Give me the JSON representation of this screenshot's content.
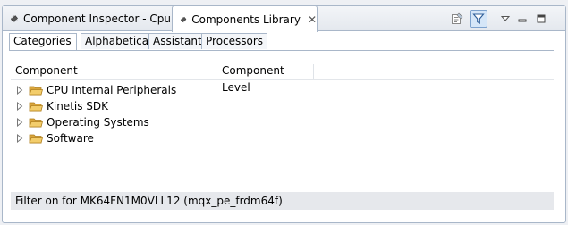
{
  "view_tabs": [
    {
      "label": "Component Inspector - Cpu",
      "active": false
    },
    {
      "label": "Components Library",
      "active": true
    }
  ],
  "toolbar": {
    "icons": [
      "properties-icon",
      "filter-icon",
      "view-menu-icon",
      "minimize-icon",
      "maximize-icon"
    ],
    "filter_active": true
  },
  "subtabs": [
    {
      "label": "Categories",
      "selected": true
    },
    {
      "label": "Alphabetical",
      "selected": false
    },
    {
      "label": "Assistant",
      "selected": false
    },
    {
      "label": "Processors",
      "selected": false
    }
  ],
  "columns": [
    "Component",
    "Component Level"
  ],
  "tree": [
    {
      "label": "CPU Internal Peripherals"
    },
    {
      "label": "Kinetis SDK"
    },
    {
      "label": "Operating Systems"
    },
    {
      "label": "Software"
    }
  ],
  "status": "Filter on for MK64FN1M0VLL12 (mqx_pe_frdm64f)",
  "colors": {
    "folder": "#e8b84a",
    "border": "#a9b7c9",
    "filter_bg": "#d5e6f8"
  }
}
